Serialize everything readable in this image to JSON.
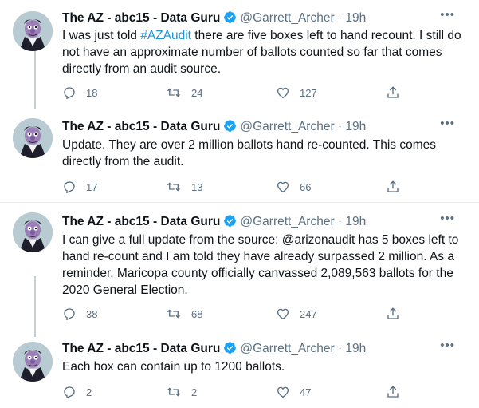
{
  "tweets": [
    {
      "name": "The AZ - abc15 - Data Guru",
      "handle": "@Garrett_Archer",
      "dot": "·",
      "time": "19h",
      "text_before": "I was just told ",
      "hashtag": "#AZAudit",
      "text_after": " there are five boxes left to hand recount. I still do not have an approximate number of ballots counted so far that comes directly from an audit source.",
      "replies": "18",
      "retweets": "24",
      "likes": "127"
    },
    {
      "name": "The AZ - abc15 - Data Guru",
      "handle": "@Garrett_Archer",
      "dot": "·",
      "time": "19h",
      "text": "Update. They are over 2 million ballots hand re-counted. This comes directly from the audit.",
      "replies": "17",
      "retweets": "13",
      "likes": "66"
    },
    {
      "name": "The AZ - abc15 - Data Guru",
      "handle": "@Garrett_Archer",
      "dot": "·",
      "time": "19h",
      "text": "I can give a full update from the source: @arizonaudit has 5 boxes left to hand re-count and I am told they have already surpassed 2 million. As a reminder, Maricopa county officially canvassed 2,089,563 ballots for the 2020 General Election.",
      "replies": "38",
      "retweets": "68",
      "likes": "247"
    },
    {
      "name": "The AZ - abc15 - Data Guru",
      "handle": "@Garrett_Archer",
      "dot": "·",
      "time": "19h",
      "text": "Each box can contain up to 1200 ballots.",
      "replies": "2",
      "retweets": "2",
      "likes": "47"
    }
  ],
  "icons": {
    "more": "more-icon",
    "verified": "verified-icon",
    "reply": "reply-icon",
    "retweet": "retweet-icon",
    "like": "like-icon",
    "share": "share-icon"
  },
  "colors": {
    "accent": "#1b95e0",
    "muted": "#5b7083",
    "thread_line": "#c4cfd6",
    "divider": "#e6ecf0"
  }
}
